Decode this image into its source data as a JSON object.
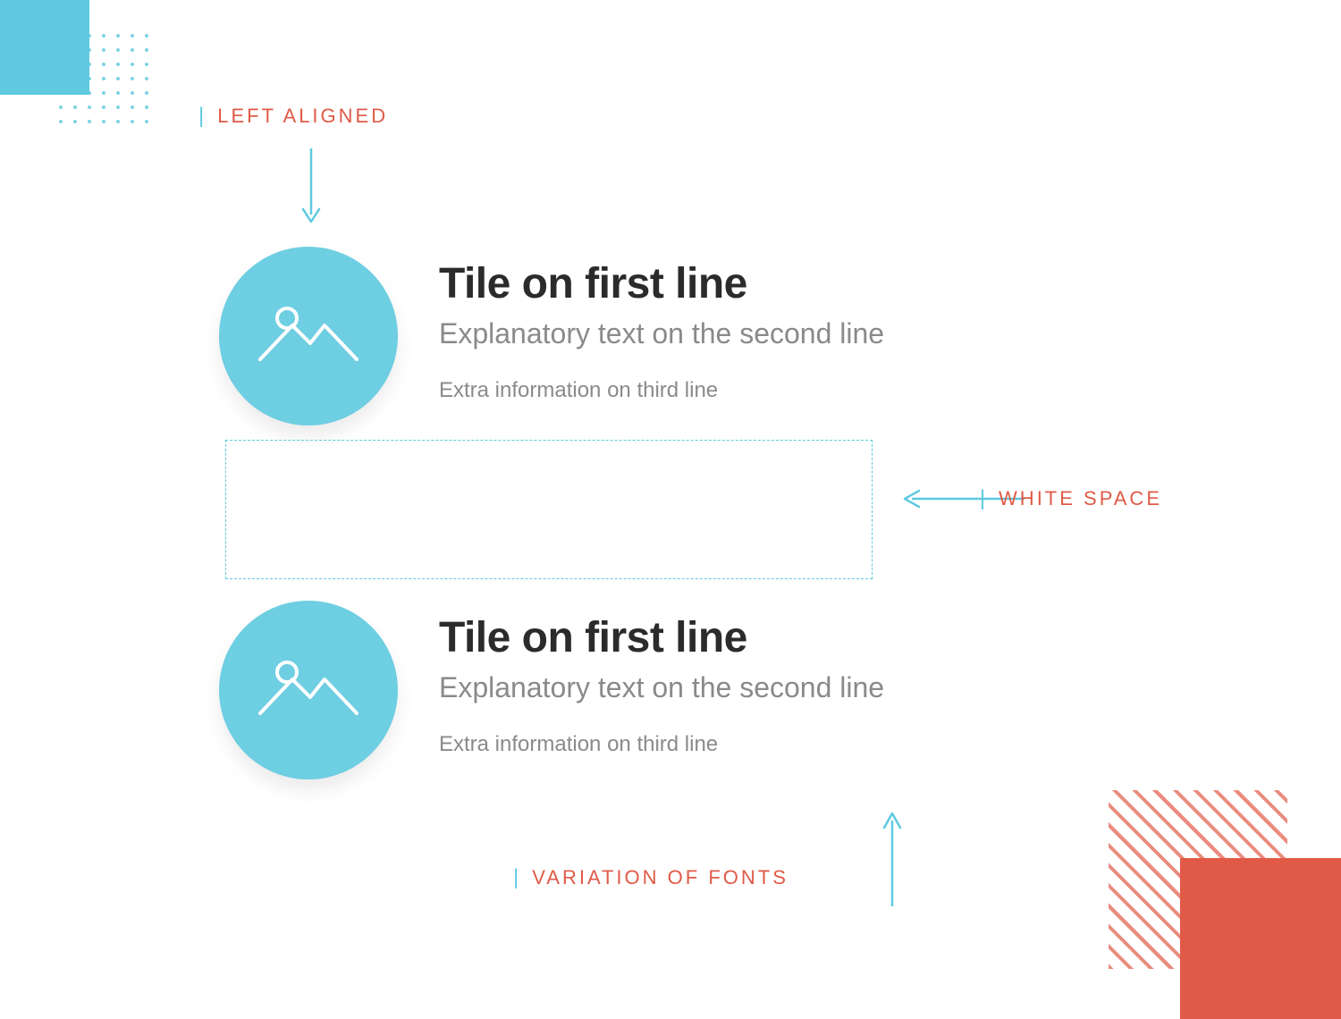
{
  "annotations": {
    "left_aligned": "LEFT ALIGNED",
    "white_space": "WHITE SPACE",
    "variation_of_fonts": "VARIATION OF FONTS"
  },
  "tiles": [
    {
      "title": "Tile on first line",
      "subtitle": "Explanatory text on the second line",
      "extra": "Extra information on third line"
    },
    {
      "title": "Tile on first line",
      "subtitle": "Explanatory text on the second line",
      "extra": "Extra information on third line"
    }
  ],
  "colors": {
    "accent_cyan": "#5ec9df",
    "accent_coral": "#e05a47",
    "text_dark": "#2b2b2b",
    "text_muted": "#8a8a8a"
  },
  "icons": {
    "avatar": "image-placeholder-icon"
  }
}
